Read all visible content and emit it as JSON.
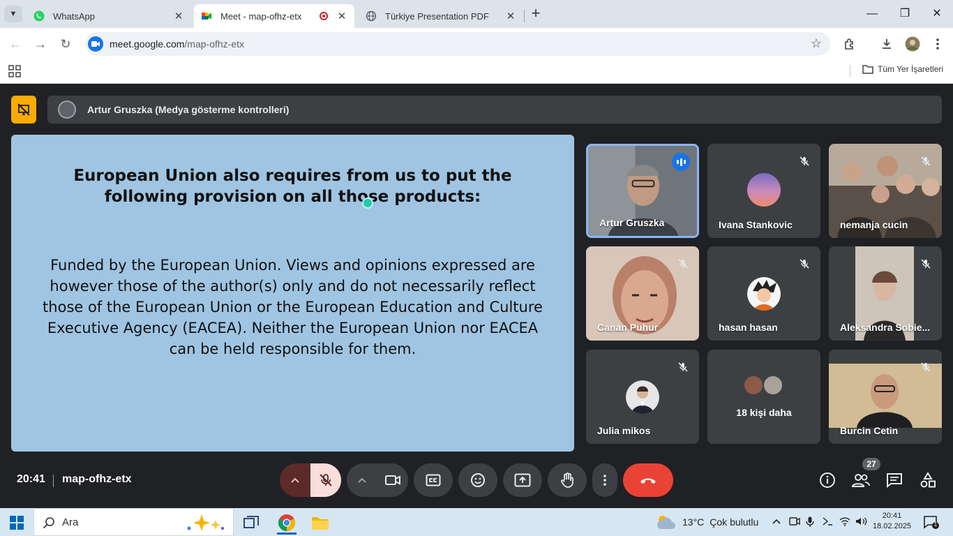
{
  "browser": {
    "tabs": [
      {
        "label": "WhatsApp",
        "active": false
      },
      {
        "label": "Meet - map-ofhz-etx",
        "active": true
      },
      {
        "label": "Türkiye Presentation PDF",
        "active": false
      }
    ],
    "close_glyph": "✕",
    "new_tab_glyph": "+",
    "url_host": "meet.google.com",
    "url_path": "/map-ofhz-etx",
    "bookmarks_all": "Tüm Yer İşaretleri"
  },
  "meet": {
    "presenter_bar": "Artur Gruszka (Medya gösterme kontrolleri)",
    "slide": {
      "title": "European Union also requires from us to put the following provision on all those products:",
      "body": "Funded by the European Union. Views and opinions expressed are however those of the author(s) only and do not necessarily reflect those of the European Union or the European Education and Culture Executive Agency (EACEA). Neither the European Union nor EACEA can be held responsible for them."
    },
    "participants": [
      {
        "name": "Artur Gruszka",
        "speaking": true,
        "muted": false
      },
      {
        "name": "Ivana Stankovic",
        "muted": true
      },
      {
        "name": "nemanja cucin",
        "muted": true
      },
      {
        "name": "Canan Puhur",
        "muted": true
      },
      {
        "name": "hasan hasan",
        "muted": true
      },
      {
        "name": "Aleksandra Sobie...",
        "muted": true
      },
      {
        "name": "Julia mikos",
        "muted": true
      },
      {
        "name": "Burcin Cetin",
        "muted": true
      }
    ],
    "more_participants": "18 kişi daha",
    "time": "20:41",
    "meeting_code": "map-ofhz-etx",
    "people_count": "27",
    "colors": {
      "stage_bg": "#202124",
      "tile_bg": "#3c4043",
      "slide_bg": "#9fc5e2",
      "stop_present": "#f9ab00",
      "end_call": "#ea4335",
      "mic_off_bg": "#f9dedc",
      "speaking_border": "#8ab4f8"
    }
  },
  "taskbar": {
    "search_label": "Ara",
    "temperature": "13°C",
    "weather": "Çok bulutlu",
    "time": "20:41",
    "date": "18.02.2025",
    "notification_count": "1"
  }
}
